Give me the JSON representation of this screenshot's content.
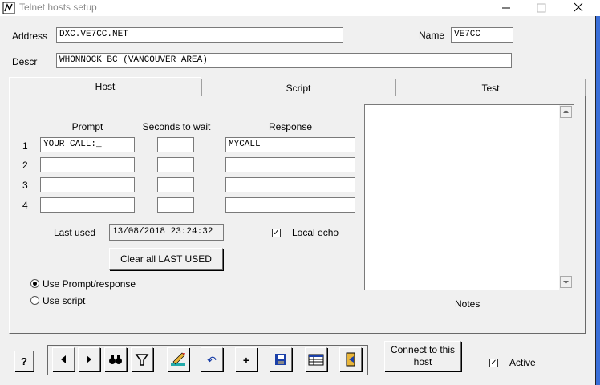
{
  "window": {
    "title": "Telnet hosts setup",
    "app_icon": "app-logo-icon"
  },
  "host": {
    "address_label": "Address",
    "address_value": "DXC.VE7CC.NET",
    "name_label": "Name",
    "name_value": "VE7CC",
    "descr_label": "Descr",
    "descr_value": "WHONNOCK BC (VANCOUVER AREA)"
  },
  "tabs": [
    {
      "label": "Host"
    },
    {
      "label": "Script"
    },
    {
      "label": "Test"
    }
  ],
  "login": {
    "col_prompt": "Prompt",
    "col_wait": "Seconds to wait",
    "col_response": "Response",
    "rows": [
      {
        "num": "1",
        "prompt": "YOUR CALL:_",
        "wait": "",
        "response": "MYCALL"
      },
      {
        "num": "2",
        "prompt": "",
        "wait": "",
        "response": ""
      },
      {
        "num": "3",
        "prompt": "",
        "wait": "",
        "response": ""
      },
      {
        "num": "4",
        "prompt": "",
        "wait": "",
        "response": ""
      }
    ]
  },
  "last_used": {
    "label": "Last used",
    "value": "13/08/2018 23:24:32"
  },
  "local_echo": {
    "label": "Local echo",
    "checked": true
  },
  "clear_button": "Clear all LAST USED",
  "mode": {
    "use_prompt_label": "Use Prompt/response",
    "use_script_label": "Use script",
    "selected": "prompt"
  },
  "notes_label": "Notes",
  "toolbar": {
    "help_glyph": "?",
    "icons": [
      "help-icon",
      "prev-icon",
      "next-icon",
      "binoculars-icon",
      "filter-icon",
      "edit-icon",
      "undo-icon",
      "add-icon",
      "save-icon",
      "grid-icon",
      "exit-icon"
    ],
    "undo_glyph": "↶",
    "add_glyph": "+"
  },
  "connect_button": "Connect to this host",
  "active": {
    "label": "Active",
    "checked": true
  }
}
